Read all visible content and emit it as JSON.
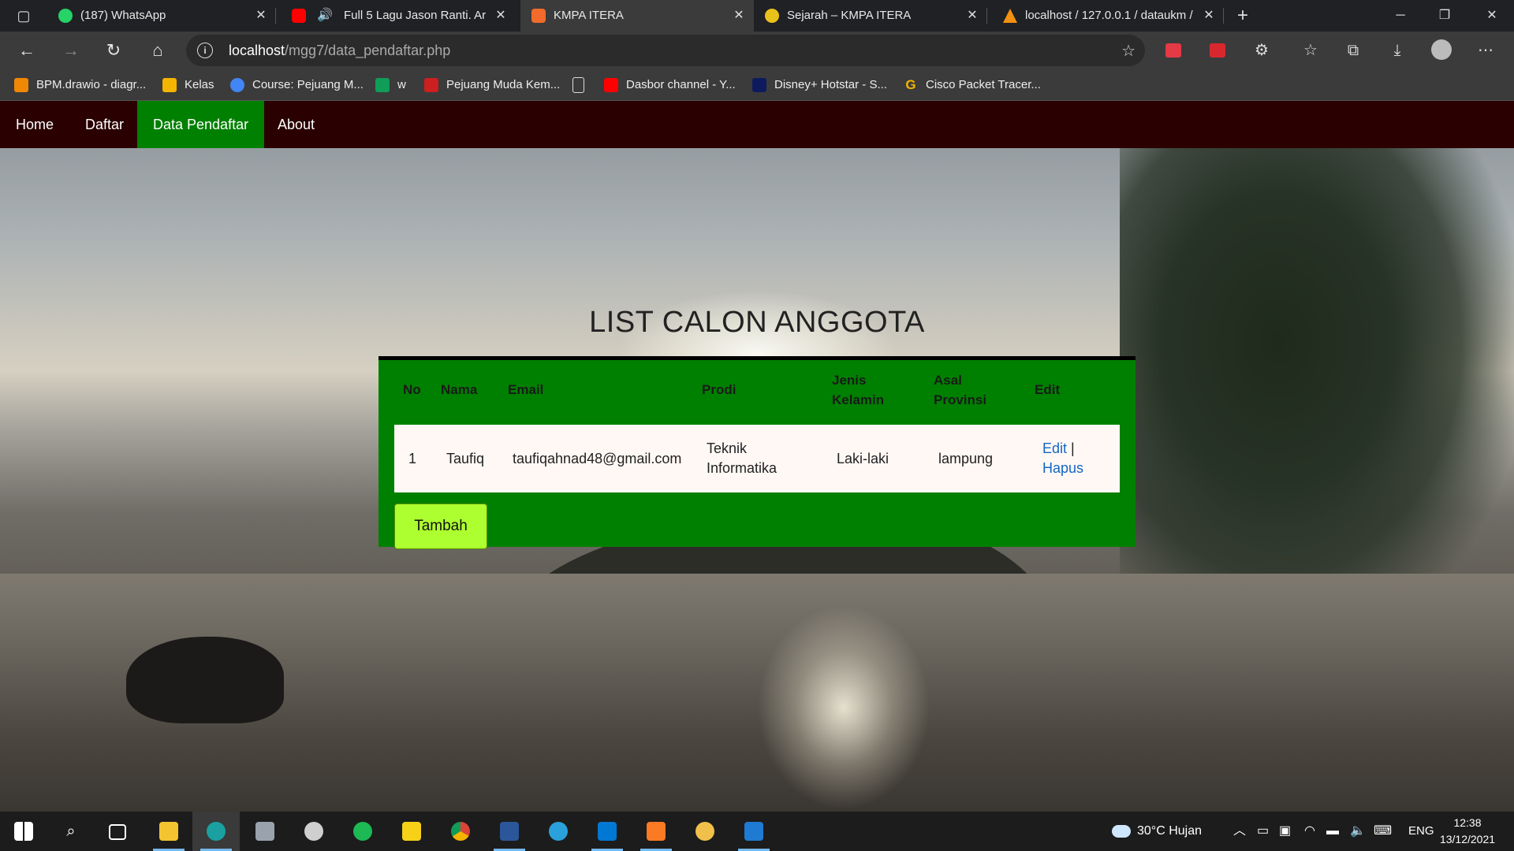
{
  "browser": {
    "tabs": [
      {
        "label": "(187) WhatsApp",
        "color": "#25d366"
      },
      {
        "label": "Full 5 Lagu Jason Ranti. Ar",
        "color": "#ff0000"
      },
      {
        "label": "KMPA ITERA",
        "color": "#f26b2a"
      },
      {
        "label": "Sejarah – KMPA ITERA",
        "color": "#e8c21b"
      },
      {
        "label": "localhost / 127.0.0.1 / dataukm /",
        "color": "#f29111"
      }
    ],
    "url_host": "localhost",
    "url_path": "/mgg7/data_pendaftar.php",
    "bookmarks": [
      {
        "label": "BPM.drawio - diagr...",
        "color": "#f08705"
      },
      {
        "label": "Kelas",
        "color": "#f4b400"
      },
      {
        "label": "Course: Pejuang M...",
        "color": "#4285f4"
      },
      {
        "label": "w",
        "color": "#0f9d58"
      },
      {
        "label": "Pejuang Muda Kem...",
        "color": "#cc1f1f"
      },
      {
        "label": "Dasbor channel - Y...",
        "color": "#ff0000"
      },
      {
        "label": "Disney+ Hotstar - S...",
        "color": "#0d1b5e"
      },
      {
        "label": "Cisco Packet Tracer...",
        "color": "#f4b400"
      }
    ]
  },
  "nav": {
    "home": "Home",
    "daftar": "Daftar",
    "data_pendaftar": "Data Pendaftar",
    "about": "About"
  },
  "page": {
    "title": "LIST CALON ANGGOTA",
    "headers": {
      "no": "No",
      "nama": "Nama",
      "email": "Email",
      "prodi": "Prodi",
      "jenis_kelamin_1": "Jenis",
      "jenis_kelamin_2": "Kelamin",
      "asal_provinsi_1": "Asal",
      "asal_provinsi_2": "Provinsi",
      "edit": "Edit"
    },
    "row": {
      "no": "1",
      "nama": "Taufiq",
      "email": "taufiqahnad48@gmail.com",
      "prodi_1": "Teknik",
      "prodi_2": "Informatika",
      "jenis_kelamin": "Laki-laki",
      "asal_provinsi": "lampung",
      "edit_link": "Edit",
      "separator": " |",
      "hapus_link": "Hapus"
    },
    "add_button": "Tambah",
    "colors": {
      "navbar": "#2a0000",
      "active_nav": "#008000",
      "card": "#008000",
      "button": "#adff2f"
    }
  },
  "taskbar": {
    "weather": "30°C  Hujan",
    "lang": "ENG",
    "time": "12:38",
    "date": "13/12/2021",
    "apps": [
      {
        "icon": "file-explorer-icon",
        "color": "#f4c430"
      },
      {
        "icon": "edge-icon",
        "color": "#1aa0a0"
      },
      {
        "icon": "app-cube-icon",
        "color": "#9aa3ad"
      },
      {
        "icon": "obs-icon",
        "color": "#cfcfcf"
      },
      {
        "icon": "spotify-icon",
        "color": "#1db954"
      },
      {
        "icon": "sticky-notes-icon",
        "color": "#f7d117"
      },
      {
        "icon": "chrome-icon",
        "color": "#db4437"
      },
      {
        "icon": "word-icon",
        "color": "#2b579a"
      },
      {
        "icon": "telegram-icon",
        "color": "#2aa1da"
      },
      {
        "icon": "vscode-icon",
        "color": "#0078d4"
      },
      {
        "icon": "xampp-icon",
        "color": "#fb7a24"
      },
      {
        "icon": "paint-icon",
        "color": "#f0c04a"
      },
      {
        "icon": "photos-icon",
        "color": "#1f7ad1"
      }
    ]
  }
}
